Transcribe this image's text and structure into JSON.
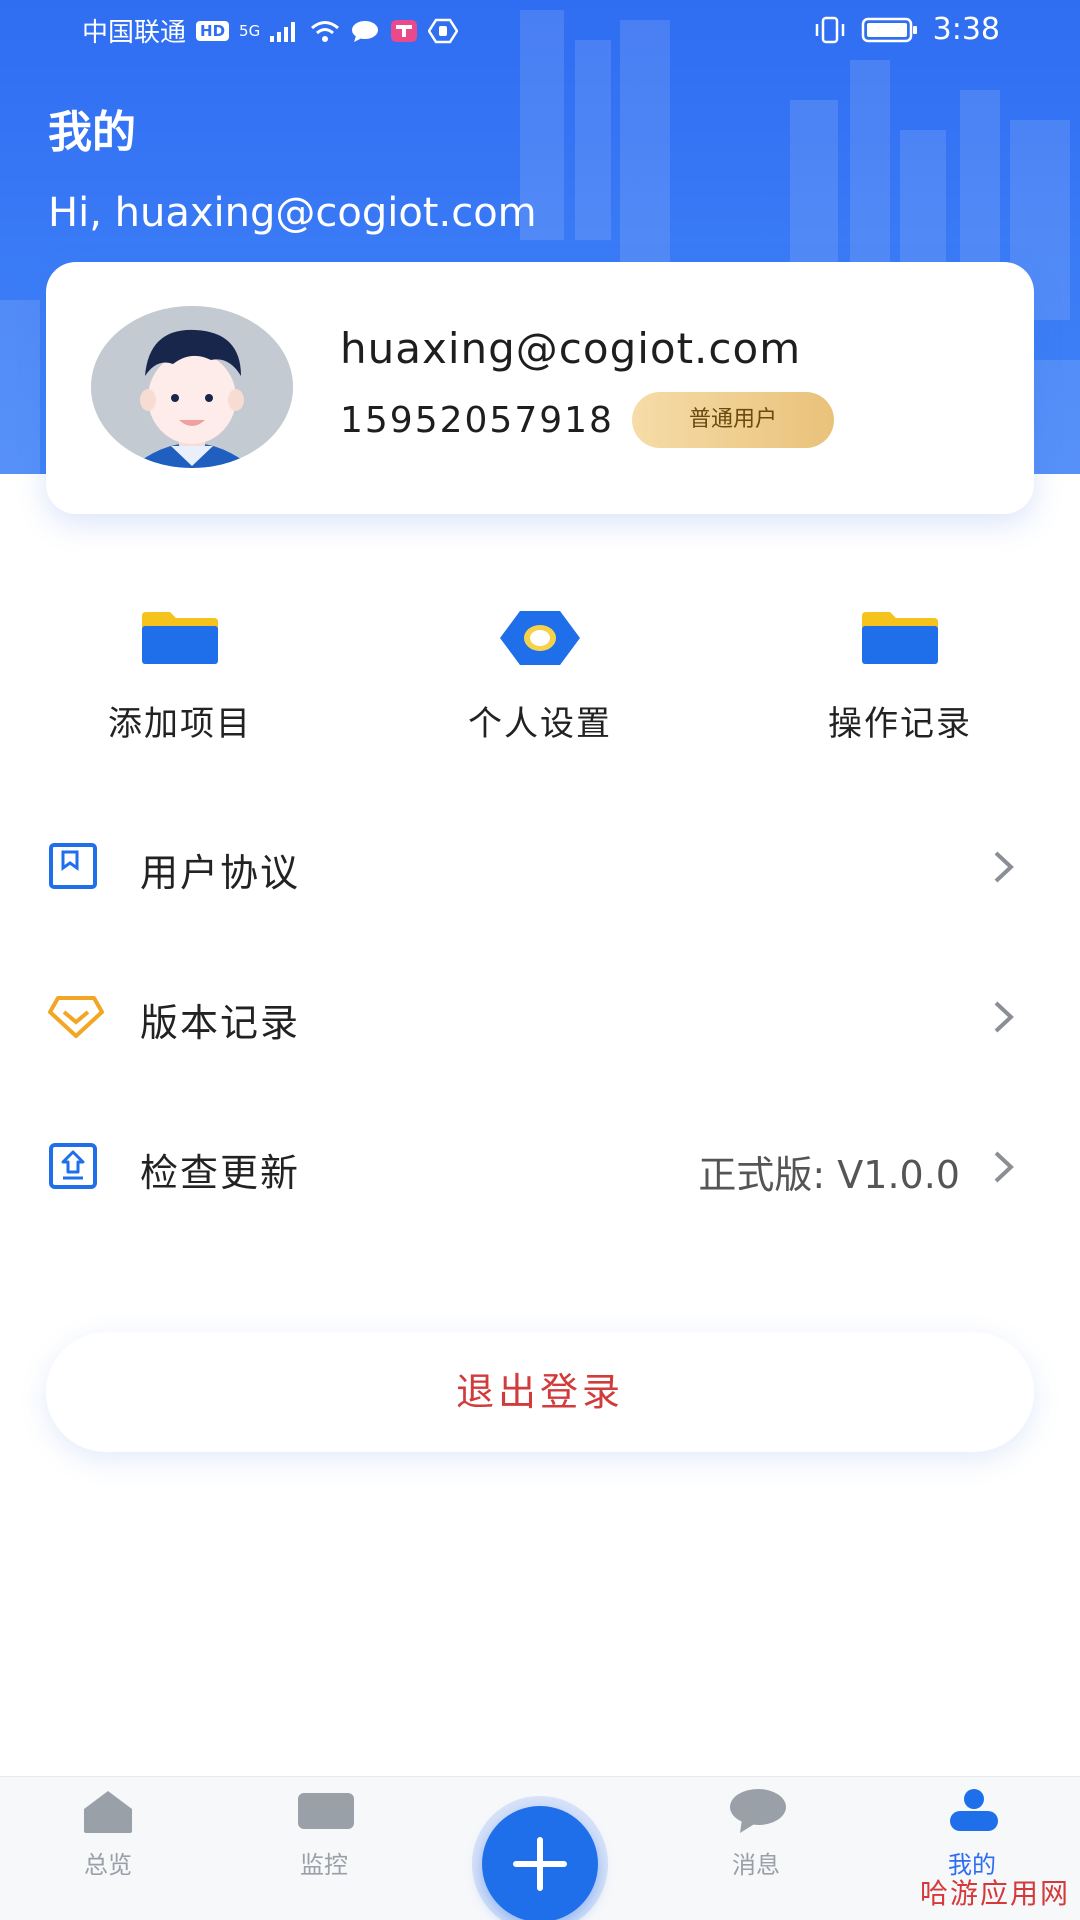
{
  "status_bar": {
    "carrier": "中国联通",
    "hd": "HD",
    "network": "5G",
    "time": "3:38"
  },
  "header": {
    "title": "我的",
    "greeting": "Hi, huaxing@cogiot.com"
  },
  "profile": {
    "email": "huaxing@cogiot.com",
    "phone": "15952057918",
    "role": "普通用户"
  },
  "quick_actions": [
    {
      "label": "添加项目",
      "icon": "folder-icon"
    },
    {
      "label": "个人设置",
      "icon": "settings-hex-icon"
    },
    {
      "label": "操作记录",
      "icon": "folder-icon"
    }
  ],
  "menu": [
    {
      "label": "用户协议",
      "icon": "agreement-icon",
      "value": ""
    },
    {
      "label": "版本记录",
      "icon": "version-icon",
      "value": ""
    },
    {
      "label": "检查更新",
      "icon": "update-icon",
      "value": "正式版: V1.0.0"
    }
  ],
  "logout_label": "退出登录",
  "tabs": [
    {
      "label": "总览",
      "icon": "home-icon",
      "active": false
    },
    {
      "label": "监控",
      "icon": "monitor-icon",
      "active": false
    },
    {
      "label": "",
      "icon": "plus-icon",
      "active": false
    },
    {
      "label": "消息",
      "icon": "message-icon",
      "active": false
    },
    {
      "label": "我的",
      "icon": "user-icon",
      "active": true
    }
  ],
  "watermark": "哈游应用网",
  "colors": {
    "primary": "#2f6df2",
    "logout": "#d23b3b",
    "badge_gold": "#e9c27a",
    "folder_blue": "#1f6fea",
    "folder_yellow": "#f6c21c",
    "version_orange": "#f2a623"
  }
}
